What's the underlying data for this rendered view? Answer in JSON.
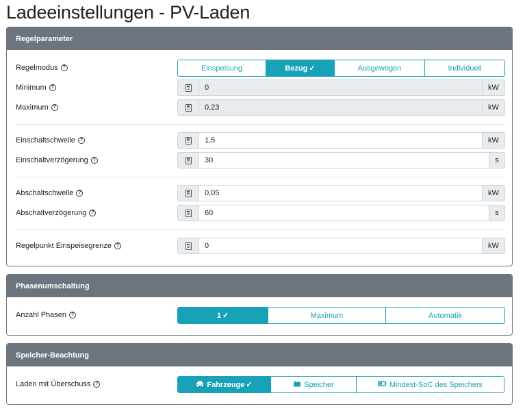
{
  "page": {
    "title": "Ladeeinstellungen - PV-Laden"
  },
  "regelparameter": {
    "header": "Regelparameter",
    "regelmodus": {
      "label": "Regelmodus",
      "options": [
        "Einspeisung",
        "Bezug",
        "Ausgewogen",
        "Individuell"
      ],
      "selected": "Bezug"
    },
    "minimum": {
      "label": "Minimum",
      "value": "0",
      "unit": "kW"
    },
    "maximum": {
      "label": "Maximum",
      "value": "0,23",
      "unit": "kW"
    },
    "einschaltschwelle": {
      "label": "Einschaltschwelle",
      "value": "1,5",
      "unit": "kW"
    },
    "einschaltverzoegerung": {
      "label": "Einschaltverzögerung",
      "value": "30",
      "unit": "s"
    },
    "abschaltschwelle": {
      "label": "Abschaltschwelle",
      "value": "0,05",
      "unit": "kW"
    },
    "abschaltverzoegerung": {
      "label": "Abschaltverzögerung",
      "value": "60",
      "unit": "s"
    },
    "regelpunkt": {
      "label": "Regelpunkt Einspeisegrenze",
      "value": "0",
      "unit": "kW"
    }
  },
  "phasenumschaltung": {
    "header": "Phasenumschaltung",
    "anzahl_phasen": {
      "label": "Anzahl Phasen",
      "options": [
        "1",
        "Maximum",
        "Automatik"
      ],
      "selected": "1"
    }
  },
  "speicher": {
    "header": "Speicher-Beachtung",
    "laden_mit_ueberschuss": {
      "label": "Laden mit Überschuss",
      "options": [
        "Fahrzeuge",
        "Speicher",
        "Mindest-SoC des Speichers"
      ],
      "selected": "Fahrzeuge"
    }
  },
  "icons": {
    "help": "question-circle-icon",
    "calculator": "calculator-icon",
    "check": "check-icon",
    "car": "car-icon",
    "car_battery": "car-battery-icon",
    "battery": "battery-half-icon"
  },
  "colors": {
    "accent": "#17a2b8",
    "header": "#6c757d"
  }
}
